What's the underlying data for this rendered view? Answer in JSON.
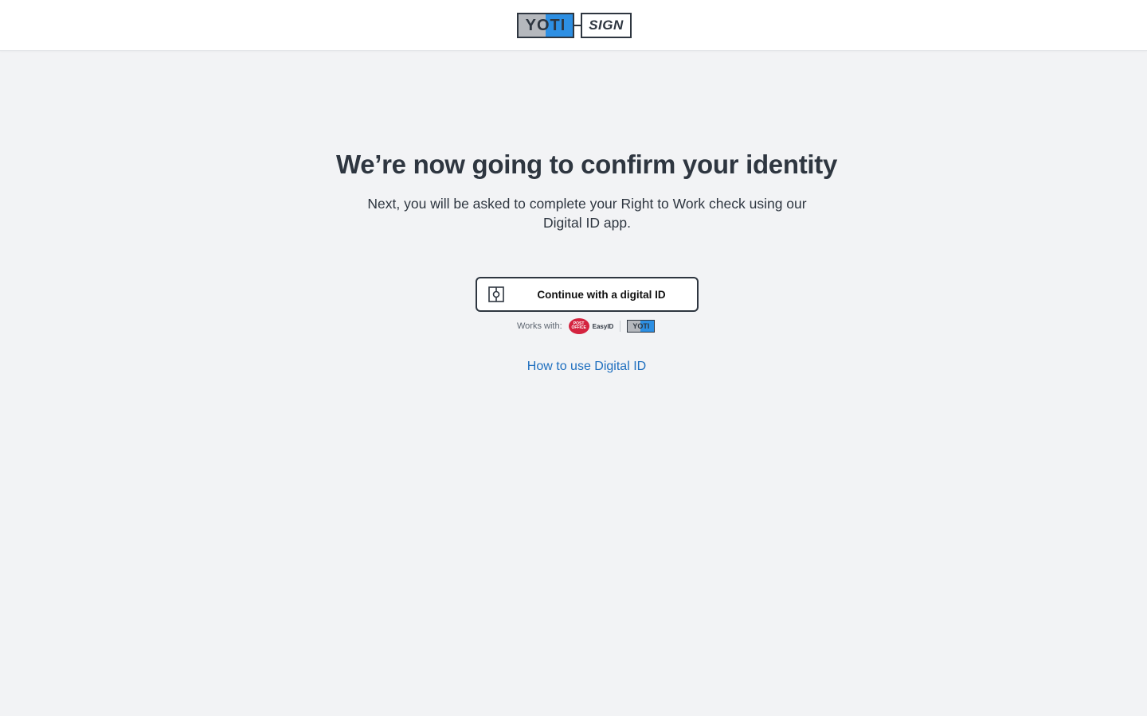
{
  "header": {
    "logo_yoti": "YOTI",
    "logo_sign": "SIGN"
  },
  "main": {
    "title": "We’re now going to confirm your identity",
    "subtitle": "Next, you will be asked to complete your Right to Work check using our Digital ID app.",
    "cta_label": "Continue with a digital ID",
    "cta_icon": "digital-id-icon",
    "works_with_label": "Works with:",
    "partners": [
      {
        "name": "Post Office",
        "logo_text": "POST OFFICE",
        "label": "EasyID"
      },
      {
        "name": "Yoti",
        "logo_text": "YOTI"
      }
    ],
    "help_link": "How to use Digital ID"
  },
  "colors": {
    "background": "#f2f3f5",
    "text": "#2e3640",
    "link": "#1f6fbf",
    "yoti_blue": "#2d8fe3",
    "post_office_red": "#d4233f"
  }
}
